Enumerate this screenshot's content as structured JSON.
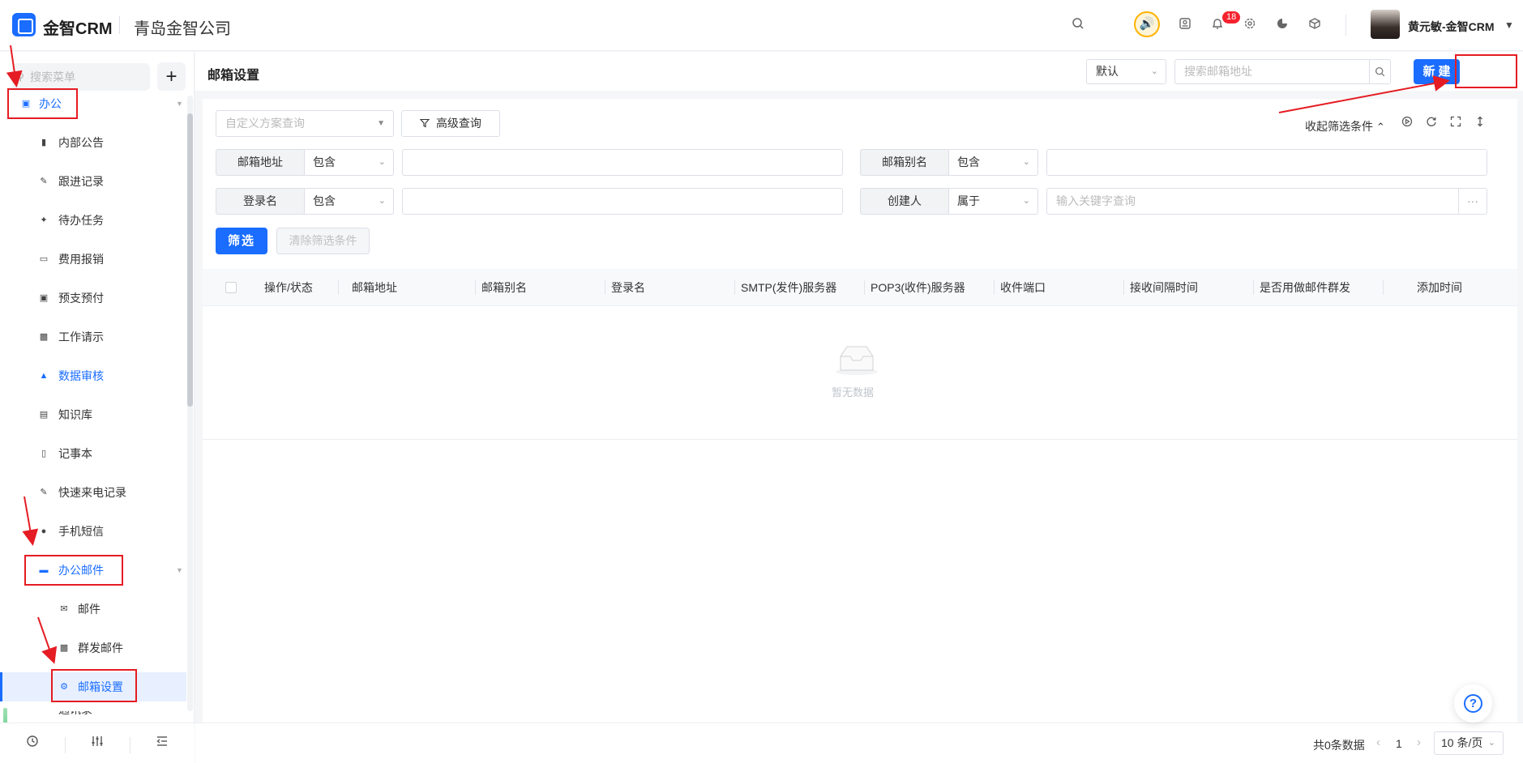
{
  "header": {
    "brand": "金智CRM",
    "company": "青岛金智公司",
    "notification_count": "18",
    "user_name": "黄元敏-金智CRM"
  },
  "sidebar": {
    "search_placeholder": "搜索菜单",
    "group_office": "办公",
    "items": [
      {
        "label": "内部公告",
        "icon": "speaker-icon"
      },
      {
        "label": "跟进记录",
        "icon": "edit-icon"
      },
      {
        "label": "待办任务",
        "icon": "pin-icon"
      },
      {
        "label": "费用报销",
        "icon": "card-icon"
      },
      {
        "label": "预支预付",
        "icon": "wallet-icon"
      },
      {
        "label": "工作请示",
        "icon": "message-icon"
      },
      {
        "label": "数据审核",
        "icon": "stamp-icon"
      },
      {
        "label": "知识库",
        "icon": "book-icon"
      },
      {
        "label": "记事本",
        "icon": "notebook-icon"
      },
      {
        "label": "快速来电记录",
        "icon": "edit-icon"
      },
      {
        "label": "手机短信",
        "icon": "chat-icon"
      }
    ],
    "group_mail": "办公邮件",
    "mail_items": [
      {
        "label": "邮件",
        "icon": "mail-icon"
      },
      {
        "label": "群发邮件",
        "icon": "bulk-mail-icon"
      },
      {
        "label": "邮箱设置",
        "icon": "gear-icon"
      }
    ],
    "cutoff_item": "通讯录"
  },
  "titlebar": {
    "title": "邮箱设置",
    "default_select": "默认",
    "search_placeholder": "搜索邮箱地址",
    "new_button": "新建"
  },
  "filters": {
    "scheme_placeholder": "自定义方案查询",
    "advanced_query": "高级查询",
    "collapse_label": "收起筛选条件",
    "rows": [
      {
        "label": "邮箱地址",
        "op": "包含"
      },
      {
        "label": "邮箱别名",
        "op": "包含"
      },
      {
        "label": "登录名",
        "op": "包含"
      },
      {
        "label": "创建人",
        "op": "属于",
        "placeholder": "输入关键字查询"
      }
    ],
    "filter_button": "筛选",
    "clear_button": "清除筛选条件"
  },
  "table": {
    "columns": [
      "操作/状态",
      "邮箱地址",
      "邮箱别名",
      "登录名",
      "SMTP(发件)服务器",
      "POP3(收件)服务器",
      "收件端口",
      "接收间隔时间",
      "是否用做邮件群发",
      "添加时间"
    ],
    "empty_text": "暂无数据"
  },
  "pagination": {
    "total": "共0条数据",
    "page": "1",
    "page_size": "10 条/页"
  },
  "colors": {
    "accent": "#1a6dff",
    "annotation": "#e51c23"
  }
}
